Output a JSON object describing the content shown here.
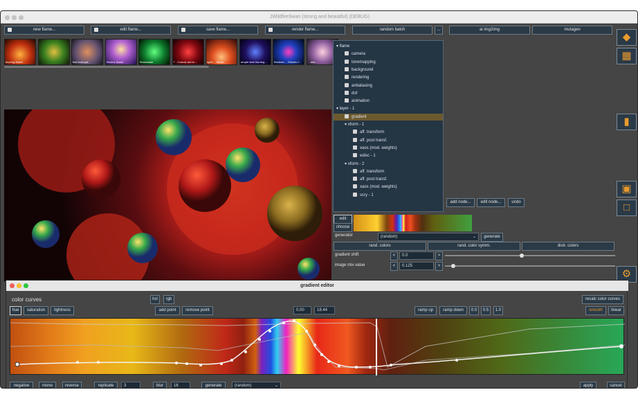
{
  "window": {
    "title": "JWildfireSwan (strong and beautiful) (DEBUG)"
  },
  "toolbar": {
    "new": "new flame...",
    "edit": "edit flame...",
    "save": "save flame...",
    "render": "render flame...",
    "random_batch": "random batch",
    "more": "...",
    "ai": "ai img2img",
    "mutagen": "mutagen"
  },
  "thumbnails": [
    "blurring flower",
    "",
    "Ball example",
    "Electric flower",
    "Brokenstar",
    "T - Cosmic ant to ...",
    "spirit ... flower",
    "simple dark blurring ...",
    "Boolean ... Electric f...",
    "... lets..."
  ],
  "tree": {
    "nodes": [
      {
        "label": "flame",
        "lvl": 0,
        "arrow": "▾",
        "icon": false
      },
      {
        "label": "camera",
        "lvl": 1,
        "icon": true
      },
      {
        "label": "tonemapping",
        "lvl": 1,
        "icon": true
      },
      {
        "label": "background",
        "lvl": 1,
        "icon": true
      },
      {
        "label": "rendering",
        "lvl": 1,
        "icon": true
      },
      {
        "label": "antialiasing",
        "lvl": 1,
        "icon": true
      },
      {
        "label": "dof",
        "lvl": 1,
        "icon": true
      },
      {
        "label": "animation",
        "lvl": 1,
        "icon": true
      },
      {
        "label": "layer - 1",
        "lvl": 0,
        "arrow": "▾",
        "icon": false
      },
      {
        "label": "gradient",
        "lvl": 1,
        "icon": true,
        "selected": true
      },
      {
        "label": "xform - 1",
        "lvl": 1,
        "arrow": "▾",
        "icon": false
      },
      {
        "label": "aff. transform",
        "lvl": 2,
        "icon": true
      },
      {
        "label": "aff. post transf.",
        "lvl": 2,
        "icon": true
      },
      {
        "label": "xaos (mod. weights)",
        "lvl": 2,
        "icon": true
      },
      {
        "label": "edisc - 1",
        "lvl": 2,
        "icon": true
      },
      {
        "label": "xform - 2",
        "lvl": 1,
        "arrow": "▾",
        "icon": false
      },
      {
        "label": "aff. transform",
        "lvl": 2,
        "icon": true
      },
      {
        "label": "aff. post transf.",
        "lvl": 2,
        "icon": true
      },
      {
        "label": "xaos (mod. weights)",
        "lvl": 2,
        "icon": true
      },
      {
        "label": "scry - 1",
        "lvl": 2,
        "icon": true
      }
    ]
  },
  "node_buttons": {
    "add": "add node...",
    "edit": "edit node...",
    "undo": "undo"
  },
  "gradient_panel": {
    "edit": "edit",
    "choose": "choose",
    "generator_label": "generator",
    "generator_value": "(random)",
    "generate": "generate",
    "rand_colors": "rand. colors",
    "rand_symm": "rand. color symm.",
    "distr_colors": "distr. colors",
    "shift_label": "gradient shift",
    "shift_value": "0.0",
    "mix_label": "image mix value",
    "mix_value": "0.125",
    "lt": "<",
    "gt": ">",
    "shift_level": 0.45,
    "mix_level": 0.05
  },
  "editor": {
    "title": "gradient editor",
    "color_curves": "color curves",
    "hsl": "hsl",
    "rgb": "rgb",
    "recalc": "recalc color curves",
    "hue": "hue",
    "saturation": "saturation",
    "lightness": "lightness",
    "add_point": "add point",
    "remove_point": "remove point",
    "pos1": "0.00",
    "pos2": "18.44",
    "ramp_up": "ramp up",
    "ramp_down": "ramp down",
    "v0": "0.0",
    "v05": "0.5",
    "v1": "1.0",
    "smooth": "smooth",
    "linear": "linear",
    "negative": "negative",
    "mono": "mono",
    "reverse": "reverse",
    "replicate": "replicate",
    "replicate_value": "3",
    "blur": "blur",
    "blur_value": "16",
    "generate": "generate",
    "generator_value": "(random)",
    "apply": "apply",
    "cancel": "cancel"
  },
  "colors": {
    "accent": "#e89b2e",
    "button_bg": "#2b3a47",
    "tree_bg": "#243544",
    "selected": "#6b5a2f"
  },
  "sidebar_icons": [
    "flame-icon",
    "grid-icon",
    "device-icon",
    "image-icon",
    "folder-icon",
    "gear-icon"
  ]
}
